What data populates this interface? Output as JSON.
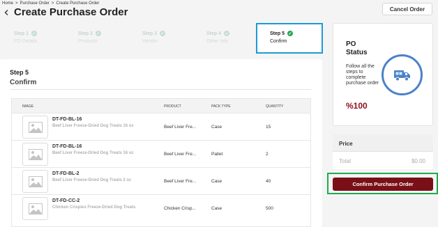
{
  "breadcrumb": [
    "Home",
    "Purchase Order",
    "Create Purchase Order"
  ],
  "breadcrumb_separator": ">",
  "page_title": "Create Purchase Order",
  "header": {
    "cancel_label": "Cancel Order",
    "back_icon": "chevron-left-icon"
  },
  "steps": [
    {
      "label": "Step 1",
      "sub": "PO Details",
      "completed": true
    },
    {
      "label": "Step 2",
      "sub": "Products",
      "completed": true
    },
    {
      "label": "Step 3",
      "sub": "Vendor",
      "completed": true
    },
    {
      "label": "Step 4",
      "sub": "Other Info",
      "completed": true
    },
    {
      "label": "Step 5",
      "sub": "Confirm",
      "completed": true,
      "active": true
    }
  ],
  "confirm_section": {
    "step_label": "Step 5",
    "title": "Confirm"
  },
  "table": {
    "columns": [
      "IMAGE",
      "PRODUCT",
      "PACK TYPE",
      "QUANTITY"
    ],
    "rows": [
      {
        "sku": "DT-FD-BL-16",
        "name": "Beef Liver Freeze-Dried Dog Treats 16 oz",
        "product": "Beef Liver Fre...",
        "pack": "Case",
        "qty": "15"
      },
      {
        "sku": "DT-FD-BL-16",
        "name": "Beef Liver Freeze-Dried Dog Treats 16 oz",
        "product": "Beef Liver Fre...",
        "pack": "Pallet",
        "qty": "2"
      },
      {
        "sku": "DT-FD-BL-2",
        "name": "Beef Liver Freeze-Dried Dog Treats 2 oz",
        "product": "Beef Liver Fre...",
        "pack": "Case",
        "qty": "40"
      },
      {
        "sku": "DT-FD-CC-2",
        "name": "Chicken Crispies Freeze-Dried Dog Treats",
        "product": "Chicken Crisp...",
        "pack": "Case",
        "qty": "500"
      }
    ]
  },
  "status": {
    "title_line1": "PO",
    "title_line2": "Status",
    "description": "Follow all the steps to complete purchase order",
    "percent": "%100",
    "icon": "delivery-truck-icon"
  },
  "price": {
    "heading": "Price",
    "total_label": "Total",
    "total_value": "$0.00"
  },
  "confirm_button_label": "Confirm Purchase Order",
  "colors": {
    "accent_blue": "#1a9bd7",
    "success_green": "#2aa656",
    "brand_maroon": "#7a1017",
    "status_blue": "#4a82c8"
  }
}
